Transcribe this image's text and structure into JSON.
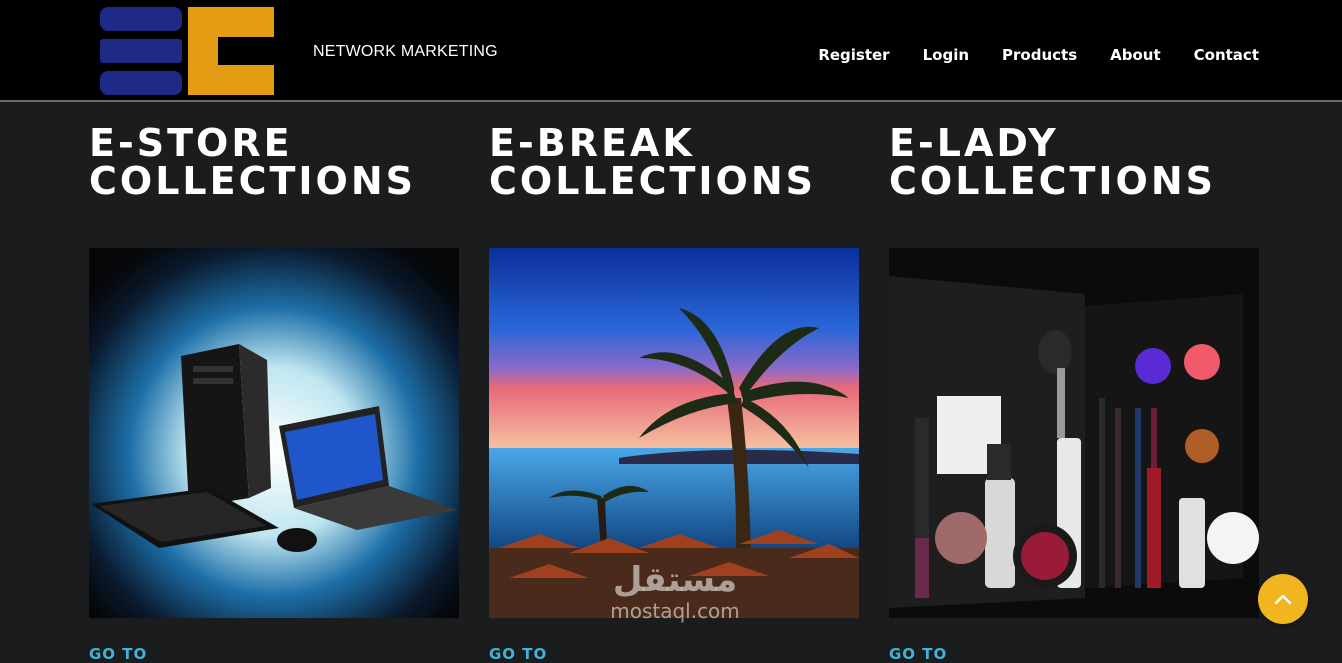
{
  "header": {
    "brand_text": "NETWORK MARKETING",
    "nav": [
      {
        "label": "Register"
      },
      {
        "label": "Login"
      },
      {
        "label": "Products"
      },
      {
        "label": "About"
      },
      {
        "label": "Contact"
      }
    ]
  },
  "collections": [
    {
      "title_line1": "E-STORE",
      "title_line2": "COLLECTIONS",
      "link": "GO TO"
    },
    {
      "title_line1": "E-BREAK",
      "title_line2": "COLLECTIONS",
      "link": "GO TO"
    },
    {
      "title_line1": "E-LADY",
      "title_line2": "COLLECTIONS",
      "link": "GO TO"
    }
  ],
  "watermark": {
    "arabic": "مستقل",
    "latin": "mostaql.com"
  },
  "colors": {
    "accent": "#f0b51f",
    "link": "#3fb4d8",
    "logo_blue": "#1f2a86",
    "logo_orange": "#e49c14",
    "background": "#1b1c1e"
  },
  "icons": {
    "back_to_top": "chevron-up-icon"
  }
}
